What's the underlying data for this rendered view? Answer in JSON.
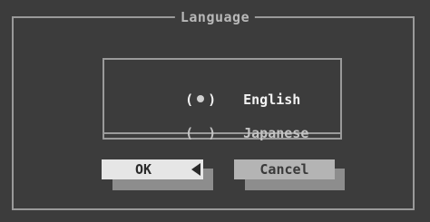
{
  "dialog": {
    "title": "Language"
  },
  "options": [
    {
      "control": "( ",
      "label": "English",
      "selected": true
    },
    {
      "control": "( ",
      "label": "Japanese",
      "selected": false
    }
  ],
  "control_close": " )",
  "buttons": {
    "ok_label": "OK",
    "cancel_label": "Cancel"
  },
  "colors": {
    "background": "#3c3c3c",
    "frame": "#9a9a9a",
    "button_focused": "#e6e6e6",
    "button_normal": "#b4b4b4",
    "shadow": "#8d8d8d"
  },
  "focused_button": "OK"
}
